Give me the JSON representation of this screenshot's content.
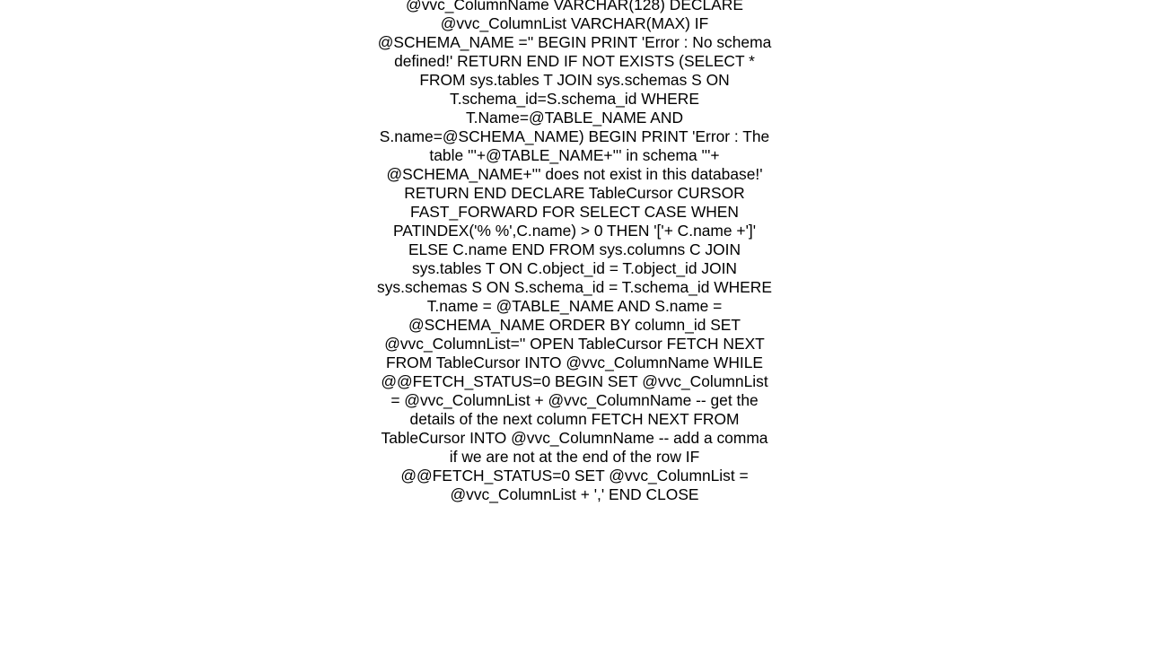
{
  "code": {
    "text": "@vvc_ColumnName VARCHAR(128) DECLARE @vvc_ColumnList VARCHAR(MAX)  IF @SCHEMA_NAME =''   BEGIN   PRINT 'Error : No schema defined!'   RETURN   END  IF NOT EXISTS (SELECT * FROM sys.tables T       JOIN sys.schemas S       ON T.schema_id=S.schema_id       WHERE T.Name=@TABLE_NAME AND S.name=@SCHEMA_NAME)   BEGIN   PRINT 'Error : The table '''+@TABLE_NAME+''' in schema '''+        @SCHEMA_NAME+''' does not exist in this database!'    RETURN  END  DECLARE TableCursor CURSOR FAST_FORWARD FOR SELECT   CASE WHEN PATINDEX('% %',C.name) > 0        THEN '['+ C.name +']'        ELSE C.name        END FROM     sys.columns C JOIN     sys.tables T ON       C.object_id  = T.object_id JOIN     sys.schemas S ON       S.schema_id  = T.schema_id WHERE    T.name    = @TABLE_NAME AND      S.name    = @SCHEMA_NAME ORDER BY column_id   SET @vvc_ColumnList=''  OPEN TableCursor FETCH NEXT FROM TableCursor INTO @vvc_ColumnName  WHILE @@FETCH_STATUS=0   BEGIN    SET @vvc_ColumnList = @vvc_ColumnList + @vvc_ColumnName     -- get the details of the next column    FETCH NEXT FROM TableCursor INTO @vvc_ColumnName    -- add a comma if we are not at the end of the row    IF @@FETCH_STATUS=0     SET @vvc_ColumnList = @vvc_ColumnList + ','    END   CLOSE"
  }
}
